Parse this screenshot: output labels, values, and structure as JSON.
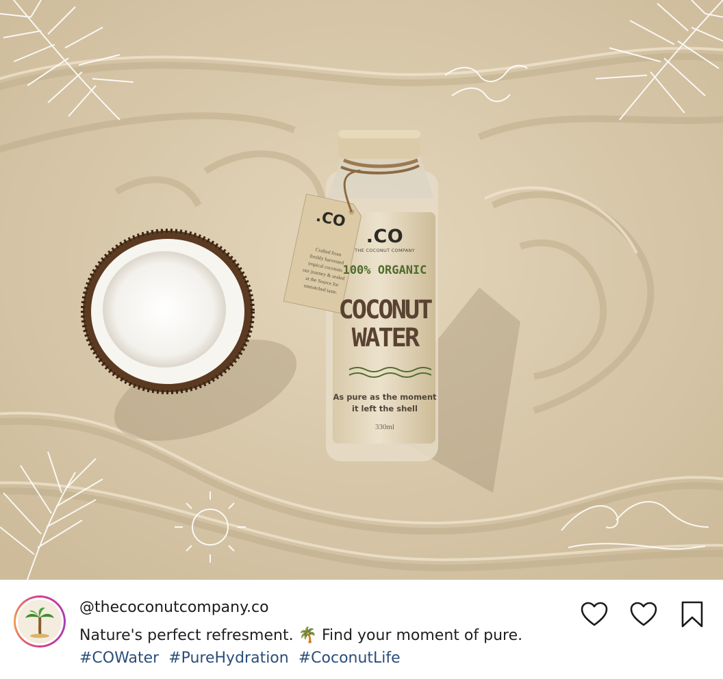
{
  "photo": {
    "bottle": {
      "brand": ".CO",
      "company": "THE COCONUT COMPANY",
      "claim": "100% ORGANIC",
      "product_line1": "COCONUT",
      "product_line2": "WATER",
      "tagline_line1": "As pure as the moment",
      "tagline_line2": "it left the shell",
      "volume": "330ml"
    },
    "hang_tag": {
      "brand": ".CO",
      "body_line1": "Crafted from",
      "body_line2": "freshly harvested",
      "body_line3": "tropical coconuts",
      "body_line4": "our journey & sealed",
      "body_line5": "at the Source for",
      "body_line6": "unmatched taste."
    }
  },
  "post": {
    "username": "@thecoconutcompany.co",
    "caption_text": "Nature's perfect refresment. 🌴 Find your moment of pure.",
    "hashtags": [
      "#COWater",
      "#PureHydration",
      "#CoconutLife"
    ],
    "avatar_emoji": "🌴"
  },
  "actions": {
    "like_icon": "heart-outline-icon",
    "second_like_icon": "heart-outline-icon",
    "save_icon": "bookmark-outline-icon"
  },
  "colors": {
    "sand": "#d9c9ac",
    "hashtag": "#2a4d78",
    "label_green": "#4f6b2c",
    "label_brown": "#5a4232"
  }
}
